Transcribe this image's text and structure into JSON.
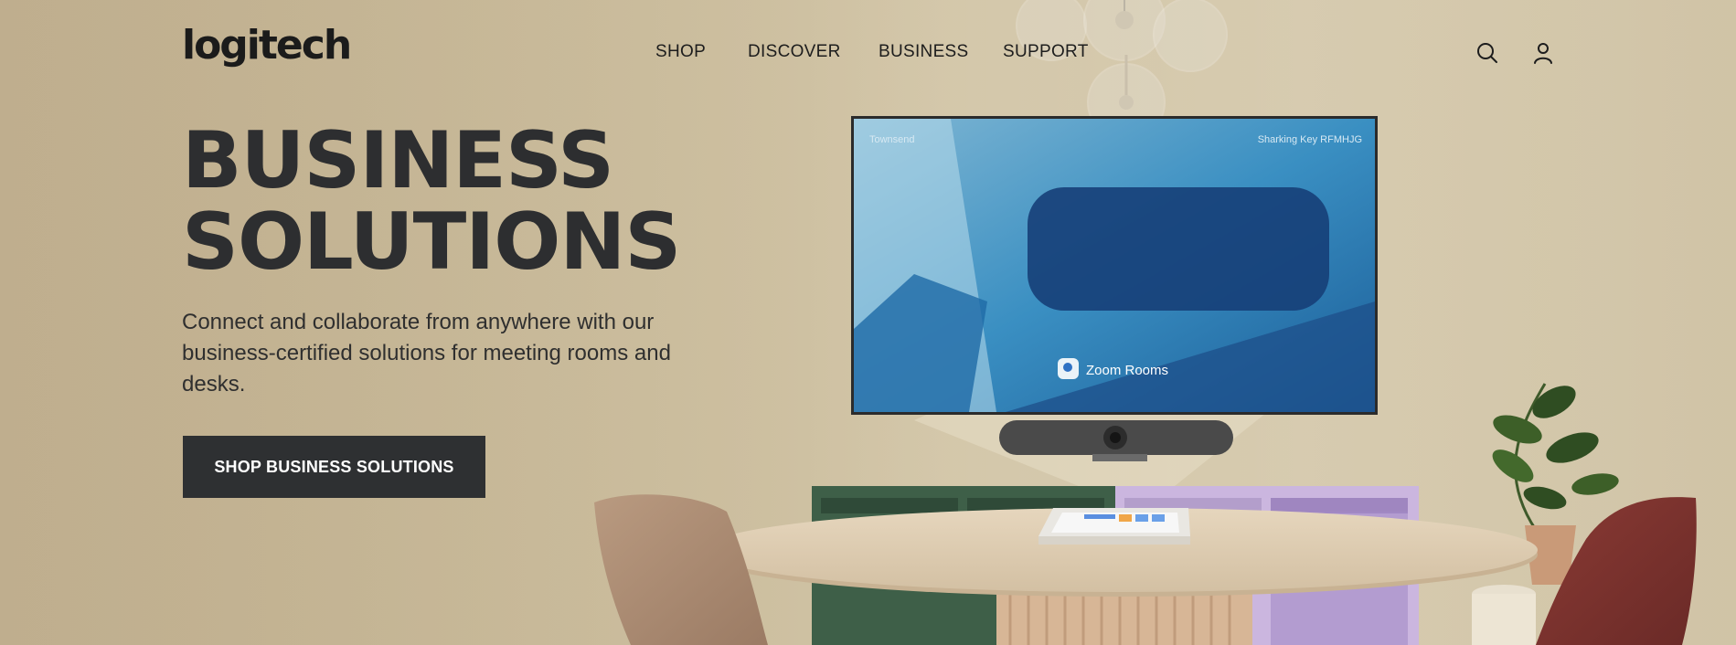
{
  "brand": {
    "logo_text": "logitech"
  },
  "nav": {
    "items": [
      {
        "label": "SHOP"
      },
      {
        "label": "DISCOVER"
      },
      {
        "label": "BUSINESS"
      },
      {
        "label": "SUPPORT"
      }
    ],
    "icons": [
      "search-icon",
      "account-icon"
    ]
  },
  "hero": {
    "headline_line1": "BUSINESS",
    "headline_line2": "SOLUTIONS",
    "subtext": "Connect and collaborate from anywhere with our business-certified solutions for meeting rooms and desks.",
    "cta_label": "SHOP BUSINESS SOLUTIONS"
  },
  "scene": {
    "tv_room_name": "Townsend",
    "tv_sharing_key": "Sharking Key RFMHJG",
    "tv_app_label": "Zoom Rooms"
  },
  "colors": {
    "background": "#c4b596",
    "text_dark": "#2d2e30",
    "button_bg": "#2e3032",
    "button_text": "#ffffff"
  }
}
